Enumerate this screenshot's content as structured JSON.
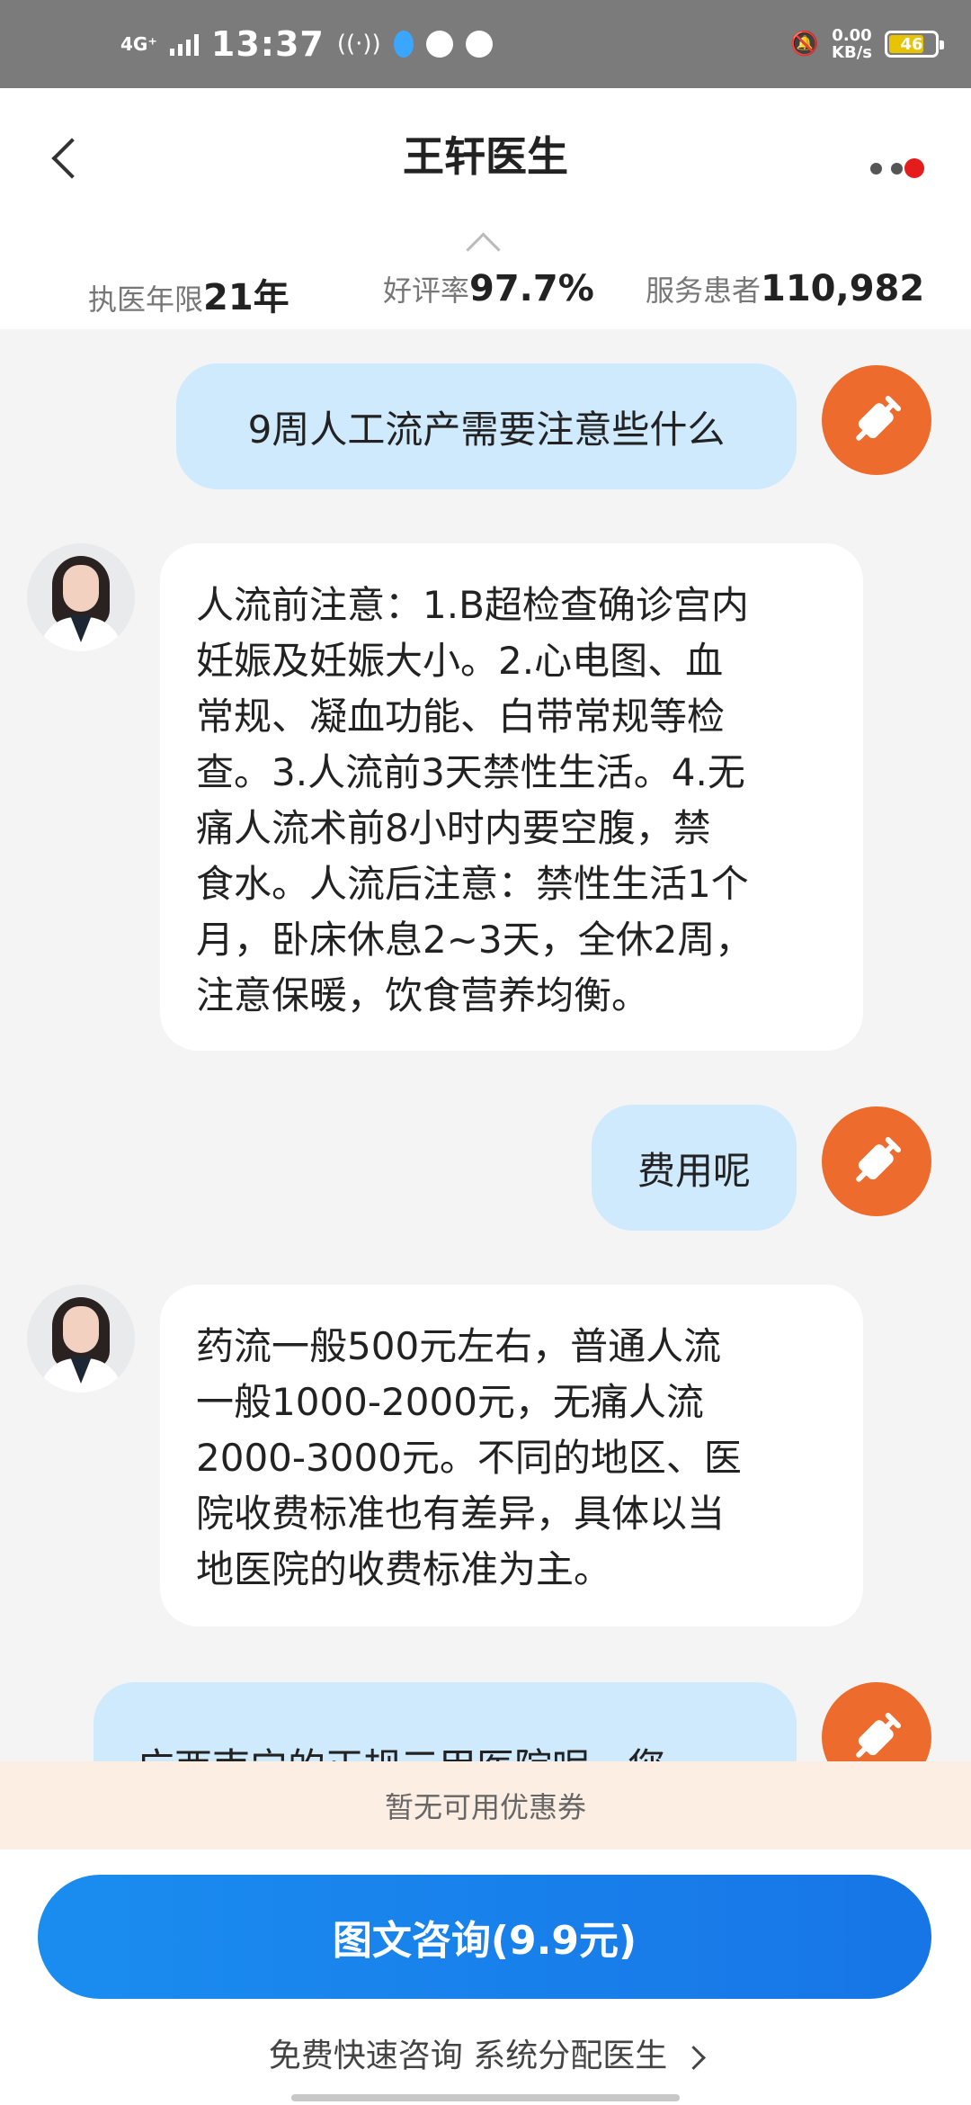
{
  "status_bar": {
    "network": "4G⁺",
    "time": "13:37",
    "speed_value": "0.00",
    "speed_unit": "KB/s",
    "battery": "46"
  },
  "header": {
    "title": "王轩医生",
    "stats": [
      {
        "label": "执医年限",
        "value": "21年"
      },
      {
        "label": "好评率",
        "value": "97.7%"
      },
      {
        "label": "服务患者",
        "value": "110,982"
      }
    ]
  },
  "messages": [
    {
      "from": "user",
      "text": "9周人工流产需要注意些什么"
    },
    {
      "from": "doctor",
      "lines": [
        "人流前注意：1.B超检查确诊宫内",
        "妊娠及妊娠大小。2.心电图、血",
        "常规、凝血功能、白带常规等检",
        "查。3.人流前3天禁性生活。4.无",
        "痛人流术前8小时内要空腹，禁",
        "食水。人流后注意：禁性生活1个",
        "月，卧床休息2~3天，全休2周，",
        "注意保暖，饮食营养均衡。"
      ]
    },
    {
      "from": "user",
      "text": "费用呢"
    },
    {
      "from": "doctor",
      "lines": [
        "药流一般500元左右，普通人流",
        "一般1000-2000元，无痛人流",
        "2000-3000元。不同的地区、医",
        "院收费标准也有差异，具体以当",
        "地医院的收费标准为主。"
      ]
    },
    {
      "from": "user",
      "text": "广西南宁的正规三甲医院呢，您"
    }
  ],
  "coupon_text": "暂无可用优惠券",
  "cta_label": "图文咨询(9.9元)",
  "free_consult_label": "免费快速咨询 系统分配医生"
}
